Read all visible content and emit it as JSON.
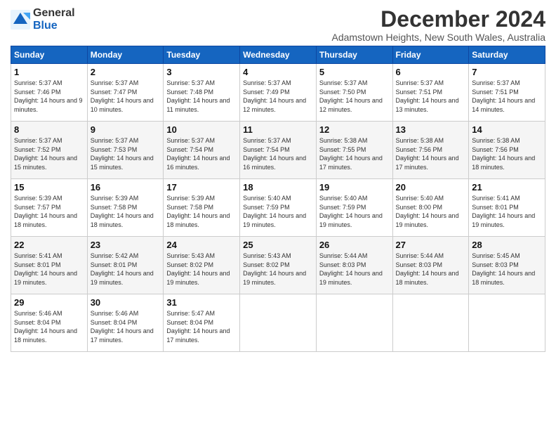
{
  "logo": {
    "general": "General",
    "blue": "Blue"
  },
  "title": "December 2024",
  "subtitle": "Adamstown Heights, New South Wales, Australia",
  "days": [
    "Sunday",
    "Monday",
    "Tuesday",
    "Wednesday",
    "Thursday",
    "Friday",
    "Saturday"
  ],
  "weeks": [
    [
      {
        "day": "1",
        "sunrise": "5:37 AM",
        "sunset": "7:46 PM",
        "daylight": "14 hours and 9 minutes."
      },
      {
        "day": "2",
        "sunrise": "5:37 AM",
        "sunset": "7:47 PM",
        "daylight": "14 hours and 10 minutes."
      },
      {
        "day": "3",
        "sunrise": "5:37 AM",
        "sunset": "7:48 PM",
        "daylight": "14 hours and 11 minutes."
      },
      {
        "day": "4",
        "sunrise": "5:37 AM",
        "sunset": "7:49 PM",
        "daylight": "14 hours and 12 minutes."
      },
      {
        "day": "5",
        "sunrise": "5:37 AM",
        "sunset": "7:50 PM",
        "daylight": "14 hours and 12 minutes."
      },
      {
        "day": "6",
        "sunrise": "5:37 AM",
        "sunset": "7:51 PM",
        "daylight": "14 hours and 13 minutes."
      },
      {
        "day": "7",
        "sunrise": "5:37 AM",
        "sunset": "7:51 PM",
        "daylight": "14 hours and 14 minutes."
      }
    ],
    [
      {
        "day": "8",
        "sunrise": "5:37 AM",
        "sunset": "7:52 PM",
        "daylight": "14 hours and 15 minutes."
      },
      {
        "day": "9",
        "sunrise": "5:37 AM",
        "sunset": "7:53 PM",
        "daylight": "14 hours and 15 minutes."
      },
      {
        "day": "10",
        "sunrise": "5:37 AM",
        "sunset": "7:54 PM",
        "daylight": "14 hours and 16 minutes."
      },
      {
        "day": "11",
        "sunrise": "5:37 AM",
        "sunset": "7:54 PM",
        "daylight": "14 hours and 16 minutes."
      },
      {
        "day": "12",
        "sunrise": "5:38 AM",
        "sunset": "7:55 PM",
        "daylight": "14 hours and 17 minutes."
      },
      {
        "day": "13",
        "sunrise": "5:38 AM",
        "sunset": "7:56 PM",
        "daylight": "14 hours and 17 minutes."
      },
      {
        "day": "14",
        "sunrise": "5:38 AM",
        "sunset": "7:56 PM",
        "daylight": "14 hours and 18 minutes."
      }
    ],
    [
      {
        "day": "15",
        "sunrise": "5:39 AM",
        "sunset": "7:57 PM",
        "daylight": "14 hours and 18 minutes."
      },
      {
        "day": "16",
        "sunrise": "5:39 AM",
        "sunset": "7:58 PM",
        "daylight": "14 hours and 18 minutes."
      },
      {
        "day": "17",
        "sunrise": "5:39 AM",
        "sunset": "7:58 PM",
        "daylight": "14 hours and 18 minutes."
      },
      {
        "day": "18",
        "sunrise": "5:40 AM",
        "sunset": "7:59 PM",
        "daylight": "14 hours and 19 minutes."
      },
      {
        "day": "19",
        "sunrise": "5:40 AM",
        "sunset": "7:59 PM",
        "daylight": "14 hours and 19 minutes."
      },
      {
        "day": "20",
        "sunrise": "5:40 AM",
        "sunset": "8:00 PM",
        "daylight": "14 hours and 19 minutes."
      },
      {
        "day": "21",
        "sunrise": "5:41 AM",
        "sunset": "8:01 PM",
        "daylight": "14 hours and 19 minutes."
      }
    ],
    [
      {
        "day": "22",
        "sunrise": "5:41 AM",
        "sunset": "8:01 PM",
        "daylight": "14 hours and 19 minutes."
      },
      {
        "day": "23",
        "sunrise": "5:42 AM",
        "sunset": "8:01 PM",
        "daylight": "14 hours and 19 minutes."
      },
      {
        "day": "24",
        "sunrise": "5:43 AM",
        "sunset": "8:02 PM",
        "daylight": "14 hours and 19 minutes."
      },
      {
        "day": "25",
        "sunrise": "5:43 AM",
        "sunset": "8:02 PM",
        "daylight": "14 hours and 19 minutes."
      },
      {
        "day": "26",
        "sunrise": "5:44 AM",
        "sunset": "8:03 PM",
        "daylight": "14 hours and 19 minutes."
      },
      {
        "day": "27",
        "sunrise": "5:44 AM",
        "sunset": "8:03 PM",
        "daylight": "14 hours and 18 minutes."
      },
      {
        "day": "28",
        "sunrise": "5:45 AM",
        "sunset": "8:03 PM",
        "daylight": "14 hours and 18 minutes."
      }
    ],
    [
      {
        "day": "29",
        "sunrise": "5:46 AM",
        "sunset": "8:04 PM",
        "daylight": "14 hours and 18 minutes."
      },
      {
        "day": "30",
        "sunrise": "5:46 AM",
        "sunset": "8:04 PM",
        "daylight": "14 hours and 17 minutes."
      },
      {
        "day": "31",
        "sunrise": "5:47 AM",
        "sunset": "8:04 PM",
        "daylight": "14 hours and 17 minutes."
      },
      null,
      null,
      null,
      null
    ]
  ]
}
